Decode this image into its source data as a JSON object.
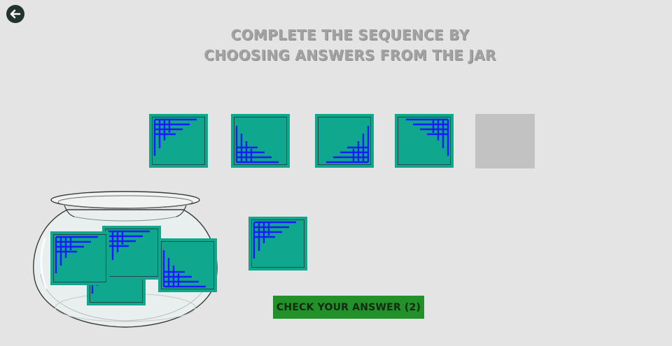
{
  "title": {
    "line1": "COMPLETE THE SEQUENCE BY",
    "line2": "CHOOSING ANSWERS FROM THE JAR"
  },
  "back_button": {
    "icon": "arrow-left-icon"
  },
  "sequence": [
    {
      "pattern": "top-left"
    },
    {
      "pattern": "bottom-left"
    },
    {
      "pattern": "bottom-right"
    },
    {
      "pattern": "top-right"
    },
    {
      "pattern": "empty"
    }
  ],
  "selected_answer": {
    "pattern": "top-left"
  },
  "jar_tiles": [
    {
      "pattern": "top-left"
    },
    {
      "pattern": "top-left"
    },
    {
      "pattern": "bottom-left"
    },
    {
      "pattern": "top-left"
    }
  ],
  "check_button": {
    "label": "CHECK YOUR ANSWER (2)"
  },
  "colors": {
    "tile": "#0fa88f",
    "lines": "#1a1aff",
    "button": "#23912a",
    "background": "#e4e4e4"
  }
}
